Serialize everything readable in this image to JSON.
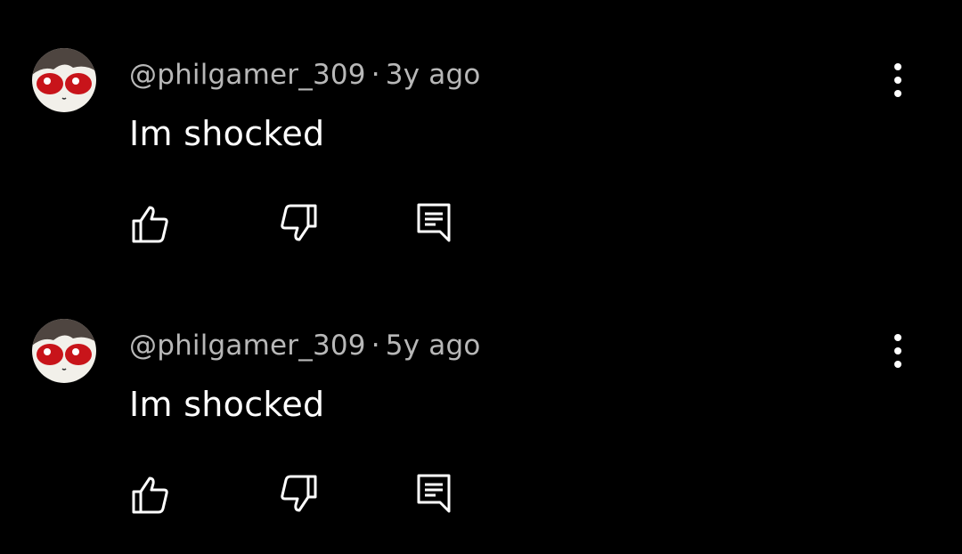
{
  "colors": {
    "background": "#000000",
    "meta_text": "#b8b8b8",
    "body_text": "#ffffff",
    "icon": "#ffffff",
    "avatar_face": "#f2f0ea",
    "avatar_hair": "#4e4540",
    "avatar_eye": "#c8141a"
  },
  "comments": [
    {
      "author": "@philgamer_309",
      "separator": "·",
      "timestamp": "3y ago",
      "text": "Im shocked",
      "avatar_icon": "avatar-face-icon",
      "menu_icon": "more-vert-icon",
      "actions": {
        "like_icon": "thumb-up-icon",
        "dislike_icon": "thumb-down-icon",
        "reply_icon": "reply-comment-icon"
      }
    },
    {
      "author": "@philgamer_309",
      "separator": "·",
      "timestamp": "5y ago",
      "text": "Im shocked",
      "avatar_icon": "avatar-face-icon",
      "menu_icon": "more-vert-icon",
      "actions": {
        "like_icon": "thumb-up-icon",
        "dislike_icon": "thumb-down-icon",
        "reply_icon": "reply-comment-icon"
      }
    }
  ]
}
